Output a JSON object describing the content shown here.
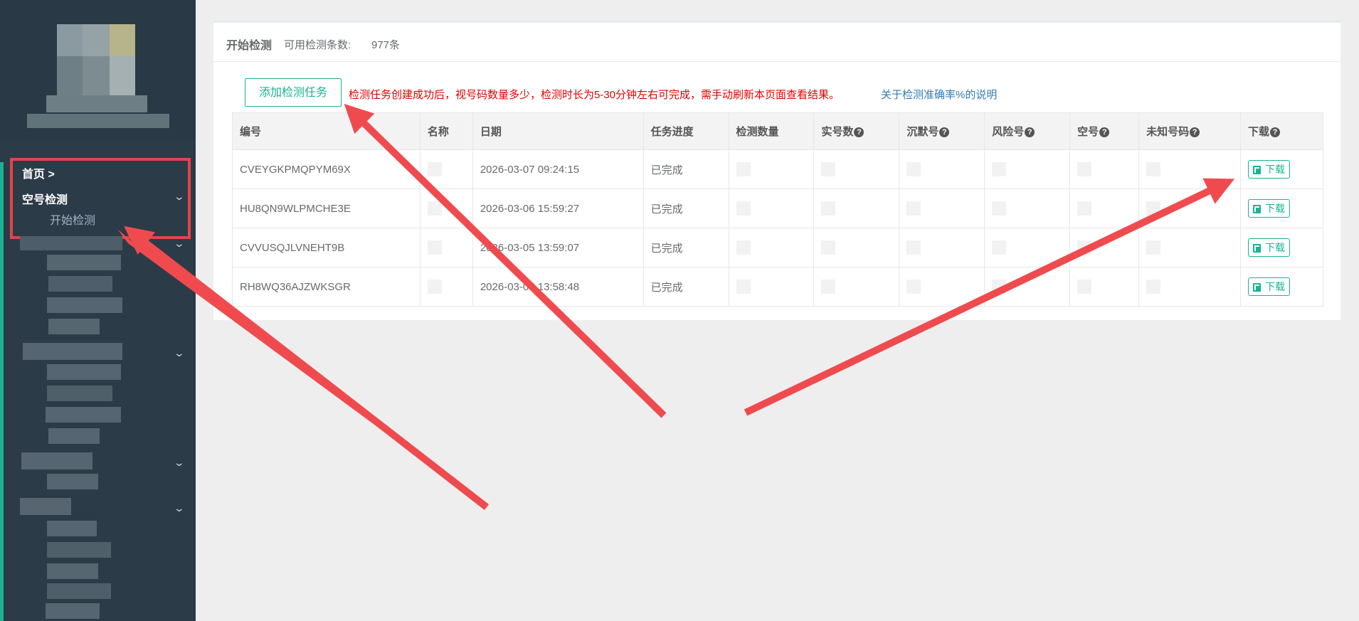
{
  "sidebar": {
    "breadcrumb": "首页 >",
    "menu_section": "空号检测",
    "menu_item": "开始检测"
  },
  "panel": {
    "title": "开始检测",
    "quota_label": "可用检测条数:",
    "quota_value": "977条"
  },
  "toolbar": {
    "add_button": "添加检测任务",
    "notice": "检测任务创建成功后，视号码数量多少，检测时长为5-30分钟左右可完成，需手动刷新本页面查看结果。",
    "accuracy_link": "关于检测准确率%的说明"
  },
  "table": {
    "headers": [
      "编号",
      "名称",
      "日期",
      "任务进度",
      "检测数量",
      "实号数",
      "沉默号",
      "风险号",
      "空号",
      "未知号码",
      "下载"
    ],
    "help_glyph": "?",
    "download_label": "下载",
    "rows": [
      {
        "id": "CVEYGKPMQPYM69X",
        "date": "2026-03-07 09:24:15",
        "status": "已完成"
      },
      {
        "id": "HU8QN9WLPMCHE3E",
        "date": "2026-03-06 15:59:27",
        "status": "已完成"
      },
      {
        "id": "CVVUSQJLVNEHT9B",
        "date": "2026-03-05 13:59:07",
        "status": "已完成"
      },
      {
        "id": "RH8WQ36AJZWKSGR",
        "date": "2026-03-05 13:58:48",
        "status": "已完成"
      }
    ]
  },
  "colors": {
    "sidebar_bg": "#2c3b48",
    "accent_green": "#1ab394",
    "notice_red": "#e40000",
    "link_blue": "#337ab7",
    "annotation_red": "#e8424a"
  },
  "icons": [
    "chevron-down-icon",
    "help-icon",
    "copy-icon"
  ]
}
